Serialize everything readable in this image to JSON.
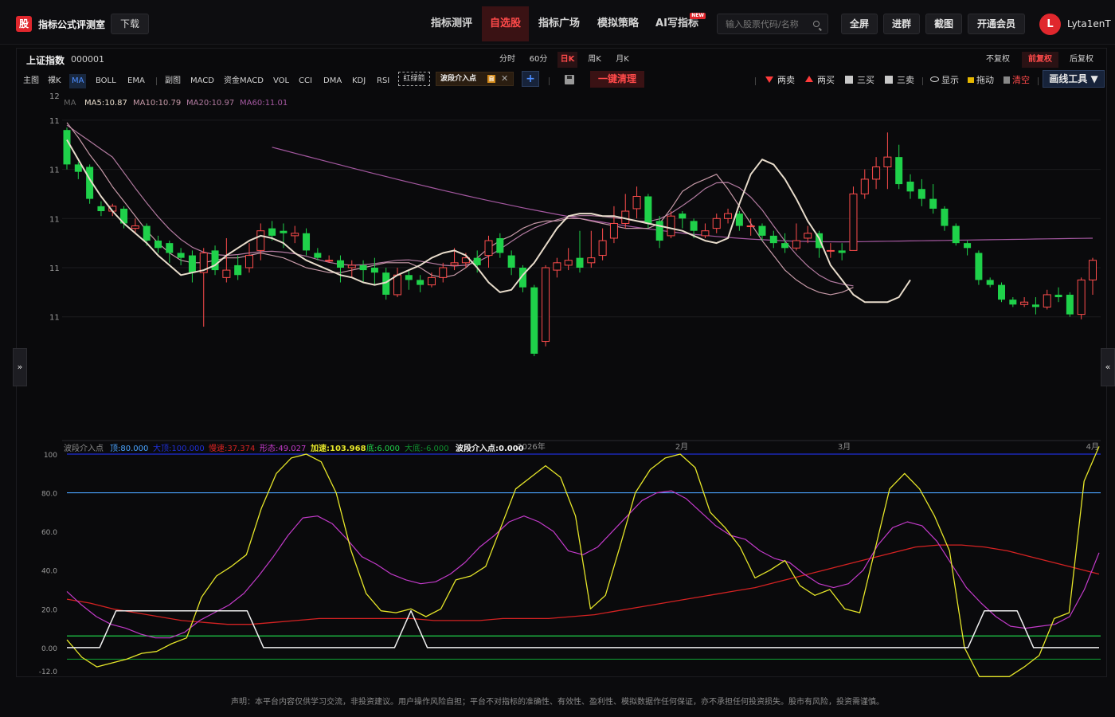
{
  "header": {
    "logo_char": "股",
    "brand": "指标公式评测室",
    "download": "下载",
    "nav": [
      {
        "label": "指标测评",
        "active": false
      },
      {
        "label": "自选股",
        "active": true
      },
      {
        "label": "指标广场",
        "active": false
      },
      {
        "label": "模拟策略",
        "active": false
      },
      {
        "label": "AI写指标",
        "active": false,
        "badge": "NEW"
      }
    ],
    "search_placeholder": "输入股票代码/名称",
    "buttons": [
      "全屏",
      "进群",
      "截图",
      "开通会员"
    ],
    "avatar_letter": "L",
    "username": "Lyta1enT"
  },
  "chart_header": {
    "index_name": "上证指数",
    "index_code": "000001",
    "periods": [
      {
        "label": "分时",
        "active": false
      },
      {
        "label": "60分",
        "active": false
      },
      {
        "label": "日K",
        "active": true
      },
      {
        "label": "周K",
        "active": false
      },
      {
        "label": "月K",
        "active": false
      }
    ],
    "adjust": [
      {
        "label": "不复权",
        "active": false
      },
      {
        "label": "前复权",
        "active": true
      },
      {
        "label": "后复权",
        "active": false
      }
    ]
  },
  "toolbar": {
    "left_items": [
      {
        "label": "主图",
        "active": false
      },
      {
        "label": "裸K",
        "active": false
      },
      {
        "label": "MA",
        "active": true
      },
      {
        "label": "BOLL",
        "active": false
      },
      {
        "label": "EMA",
        "active": false
      },
      {
        "label": "副图",
        "active": false
      },
      {
        "label": "MACD",
        "active": false
      },
      {
        "label": "资金MACD",
        "active": false
      },
      {
        "label": "VOL",
        "active": false
      },
      {
        "label": "CCI",
        "active": false
      },
      {
        "label": "DMA",
        "active": false
      },
      {
        "label": "KDJ",
        "active": false
      },
      {
        "label": "RSI",
        "active": false
      }
    ],
    "dashed_tag": "红绿箭",
    "wave_tag": "波段介入点",
    "wave_badge": "自",
    "wave_close": "✕",
    "add_label": "+",
    "clear_label": "一键清理",
    "right_items": [
      "两卖",
      "两买",
      "三买",
      "三卖",
      "显示",
      "拖动",
      "清空"
    ],
    "draw_tools": "画线工具 ▼"
  },
  "side_tabs": {
    "left": "»",
    "right": "«"
  },
  "chart_data": [
    {
      "type": "candlestick",
      "title": "",
      "legend": [
        {
          "name": "MA",
          "value": "",
          "color": "#666666"
        },
        {
          "name": "MA5",
          "value": "10.87",
          "color": "#e8dccb"
        },
        {
          "name": "MA10",
          "value": "10.79",
          "color": "#c79aa8"
        },
        {
          "name": "MA20",
          "value": "10.97",
          "color": "#b27aa0"
        },
        {
          "name": "MA60",
          "value": "11.01",
          "color": "#a458a0"
        }
      ],
      "y_tick_labels": [
        "12",
        "11",
        "11",
        "11",
        "11",
        "11"
      ],
      "x_tick_labels": [
        "2026年",
        "2月",
        "3月",
        "4月"
      ],
      "ylim": [
        10.6,
        12.0
      ],
      "colors": {
        "up": "#ff4d4d",
        "down": "#1fd14a"
      },
      "candles": [
        [
          11.86,
          11.72,
          11.87,
          11.7
        ],
        [
          11.72,
          11.69,
          11.73,
          11.66
        ],
        [
          11.71,
          11.58,
          11.72,
          11.56
        ],
        [
          11.55,
          11.53,
          11.57,
          11.51
        ],
        [
          11.53,
          11.55,
          11.56,
          11.51
        ],
        [
          11.54,
          11.48,
          11.55,
          11.46
        ],
        [
          11.46,
          11.47,
          11.5,
          11.44
        ],
        [
          11.47,
          11.41,
          11.48,
          11.39
        ],
        [
          11.41,
          11.38,
          11.43,
          11.36
        ],
        [
          11.4,
          11.36,
          11.41,
          11.32
        ],
        [
          11.36,
          11.34,
          11.38,
          11.31
        ],
        [
          11.35,
          11.28,
          11.37,
          11.24
        ],
        [
          11.28,
          11.36,
          11.38,
          11.06
        ],
        [
          11.37,
          11.29,
          11.39,
          11.27
        ],
        [
          11.26,
          11.29,
          11.42,
          11.24
        ],
        [
          11.31,
          11.27,
          11.35,
          11.25
        ],
        [
          11.3,
          11.35,
          11.4,
          11.28
        ],
        [
          11.37,
          11.45,
          11.48,
          11.33
        ],
        [
          11.46,
          11.43,
          11.49,
          11.41
        ],
        [
          11.45,
          11.44,
          11.48,
          11.38
        ],
        [
          11.43,
          11.44,
          11.47,
          11.4
        ],
        [
          11.44,
          11.37,
          11.46,
          11.35
        ],
        [
          11.36,
          11.34,
          11.38,
          11.33
        ],
        [
          11.33,
          11.33,
          11.35,
          11.32
        ],
        [
          11.33,
          11.3,
          11.35,
          11.24
        ],
        [
          11.3,
          11.31,
          11.33,
          11.26
        ],
        [
          11.31,
          11.29,
          11.33,
          11.24
        ],
        [
          11.3,
          11.28,
          11.34,
          11.23
        ],
        [
          11.28,
          11.19,
          11.3,
          11.17
        ],
        [
          11.19,
          11.27,
          11.3,
          11.18
        ],
        [
          11.27,
          11.25,
          11.29,
          11.21
        ],
        [
          11.25,
          11.23,
          11.27,
          11.2
        ],
        [
          11.23,
          11.26,
          11.28,
          11.22
        ],
        [
          11.26,
          11.3,
          11.32,
          11.24
        ],
        [
          11.31,
          11.32,
          11.38,
          11.29
        ],
        [
          11.32,
          11.34,
          11.36,
          11.3
        ],
        [
          11.34,
          11.31,
          11.37,
          11.28
        ],
        [
          11.35,
          11.41,
          11.43,
          11.3
        ],
        [
          11.42,
          11.36,
          11.44,
          11.34
        ],
        [
          11.35,
          11.3,
          11.37,
          11.27
        ],
        [
          11.3,
          11.22,
          11.31,
          11.2
        ],
        [
          11.22,
          10.95,
          11.23,
          10.94
        ],
        [
          11.0,
          11.3,
          11.31,
          10.98
        ],
        [
          11.29,
          11.32,
          11.34,
          11.26
        ],
        [
          11.31,
          11.33,
          11.38,
          11.29
        ],
        [
          11.34,
          11.3,
          11.45,
          11.28
        ],
        [
          11.32,
          11.34,
          11.45,
          11.3
        ],
        [
          11.35,
          11.41,
          11.46,
          11.33
        ],
        [
          11.42,
          11.48,
          11.55,
          11.4
        ],
        [
          11.48,
          11.53,
          11.6,
          11.46
        ],
        [
          11.54,
          11.59,
          11.63,
          11.5
        ],
        [
          11.59,
          11.48,
          11.6,
          11.46
        ],
        [
          11.49,
          11.41,
          11.51,
          11.38
        ],
        [
          11.43,
          11.51,
          11.53,
          11.42
        ],
        [
          11.52,
          11.5,
          11.53,
          11.46
        ],
        [
          11.49,
          11.45,
          11.5,
          11.42
        ],
        [
          11.43,
          11.45,
          11.48,
          11.42
        ],
        [
          11.46,
          11.5,
          11.52,
          11.44
        ],
        [
          11.5,
          11.52,
          11.54,
          11.48
        ],
        [
          11.52,
          11.47,
          11.53,
          11.45
        ],
        [
          11.47,
          11.47,
          11.5,
          11.43
        ],
        [
          11.47,
          11.43,
          11.48,
          11.41
        ],
        [
          11.43,
          11.4,
          11.45,
          11.38
        ],
        [
          11.4,
          11.38,
          11.44,
          11.36
        ],
        [
          11.38,
          11.41,
          11.48,
          11.37
        ],
        [
          11.42,
          11.44,
          11.47,
          11.4
        ],
        [
          11.44,
          11.38,
          11.45,
          11.34
        ],
        [
          11.37,
          11.37,
          11.4,
          11.34
        ],
        [
          11.37,
          11.36,
          11.4,
          11.33
        ],
        [
          11.37,
          11.6,
          11.63,
          11.58
        ],
        [
          11.6,
          11.66,
          11.7,
          11.58
        ],
        [
          11.66,
          11.71,
          11.75,
          11.62
        ],
        [
          11.71,
          11.75,
          11.85,
          11.62
        ],
        [
          11.75,
          11.64,
          11.8,
          11.62
        ],
        [
          11.65,
          11.61,
          11.68,
          11.58
        ],
        [
          11.62,
          11.58,
          11.66,
          11.55
        ],
        [
          11.58,
          11.54,
          11.64,
          11.52
        ],
        [
          11.54,
          11.47,
          11.55,
          11.45
        ],
        [
          11.47,
          11.4,
          11.48,
          11.39
        ],
        [
          11.4,
          11.38,
          11.41,
          11.35
        ],
        [
          11.36,
          11.25,
          11.37,
          11.23
        ],
        [
          11.25,
          11.23,
          11.26,
          11.22
        ],
        [
          11.23,
          11.17,
          11.24,
          11.16
        ],
        [
          11.17,
          11.15,
          11.18,
          11.14
        ],
        [
          11.15,
          11.16,
          11.18,
          11.14
        ],
        [
          11.15,
          11.14,
          11.18,
          11.11
        ],
        [
          11.14,
          11.19,
          11.21,
          11.13
        ],
        [
          11.19,
          11.18,
          11.22,
          11.16
        ],
        [
          11.19,
          11.11,
          11.2,
          11.1
        ],
        [
          11.11,
          11.25,
          11.26,
          11.09
        ],
        [
          11.25,
          11.33,
          11.34,
          11.19
        ]
      ],
      "ma5": [
        11.82,
        11.74,
        11.66,
        11.59,
        11.53,
        11.48,
        11.44,
        11.4,
        11.35,
        11.31,
        11.27,
        11.28,
        11.29,
        11.31,
        11.35,
        11.38,
        11.41,
        11.43,
        11.42,
        11.4,
        11.36,
        11.33,
        11.31,
        11.29,
        11.27,
        11.26,
        11.24,
        11.23,
        11.24,
        11.27,
        11.29,
        11.31,
        11.34,
        11.36,
        11.37,
        11.35,
        11.3,
        11.24,
        11.2,
        11.21,
        11.27,
        11.32,
        11.39,
        11.46,
        11.51,
        11.52,
        11.52,
        11.51,
        11.51,
        11.5,
        11.49,
        11.48,
        11.47,
        11.46,
        11.45,
        11.43,
        11.41,
        11.4,
        11.42,
        11.56,
        11.68,
        11.74,
        11.72,
        11.66,
        11.58,
        11.49,
        11.42,
        11.31,
        11.25,
        11.19,
        11.16,
        11.16,
        11.16,
        11.18,
        11.25
      ],
      "ma10": [
        11.89,
        11.83,
        11.76,
        11.7,
        11.63,
        11.57,
        11.51,
        11.45,
        11.4,
        11.36,
        11.33,
        11.32,
        11.32,
        11.33,
        11.34,
        11.34,
        11.35,
        11.36,
        11.35,
        11.34,
        11.32,
        11.3,
        11.29,
        11.28,
        11.28,
        11.29,
        11.3,
        11.31,
        11.32,
        11.32,
        11.32,
        11.3,
        11.27,
        11.26,
        11.27,
        11.3,
        11.34,
        11.38,
        11.41,
        11.43,
        11.46,
        11.48,
        11.49,
        11.49,
        11.5,
        11.5,
        11.49,
        11.48,
        11.47,
        11.46,
        11.46,
        11.46,
        11.48,
        11.54,
        11.61,
        11.64,
        11.66,
        11.68,
        11.62,
        11.55,
        11.48,
        11.41,
        11.35,
        11.29,
        11.25,
        11.22,
        11.2,
        11.19,
        11.2,
        11.22
      ]
    },
    {
      "type": "line",
      "title": "",
      "legend": [
        {
          "name": "波段介入点",
          "value": "",
          "color": "#888888"
        },
        {
          "name": "顶",
          "value": "80.000",
          "color": "#4aa3ff"
        },
        {
          "name": "大顶",
          "value": "100.000",
          "color": "#1f2fd6"
        },
        {
          "name": "慢速",
          "value": "37.374",
          "color": "#d42222"
        },
        {
          "name": "形态",
          "value": "49.027",
          "color": "#c23ac9"
        },
        {
          "name": "加速",
          "value": "103.968",
          "color": "#e6e629"
        },
        {
          "name": "底",
          "value": "6.000",
          "color": "#1fd14a"
        },
        {
          "name": "大底",
          "value": "-6.000",
          "color": "#0f8f2f"
        },
        {
          "name": "波段介入点",
          "value": "0.000",
          "color": "#f0f0f0"
        }
      ],
      "y_tick_labels": [
        "100",
        "80.0",
        "60.0",
        "40.0",
        "20.0",
        "0.00",
        "-12.0"
      ],
      "ylim": [
        -12,
        100
      ],
      "levels": {
        "top": 80,
        "big_top": 100,
        "bottom": 6,
        "big_bottom": -6
      },
      "fast": [
        4,
        -5,
        -10,
        -8,
        -6,
        -3,
        -2,
        2,
        5,
        26,
        37,
        42,
        48,
        72,
        90,
        98,
        100,
        96,
        80,
        50,
        28,
        19,
        18,
        20,
        16,
        20,
        35,
        37,
        42,
        62,
        82,
        88,
        94,
        88,
        68,
        20,
        27,
        53,
        80,
        92,
        98,
        100,
        93,
        70,
        62,
        52,
        36,
        40,
        45,
        32,
        27,
        30,
        20,
        18,
        50,
        82,
        90,
        82,
        68,
        50,
        0,
        -15,
        -15,
        -15,
        -10,
        -4,
        15,
        18,
        86,
        103.968
      ],
      "slow": [
        25,
        23,
        20,
        18,
        16,
        14,
        13,
        12,
        12,
        13,
        14,
        15,
        15,
        15,
        15,
        15,
        14,
        14,
        14,
        15,
        15,
        15,
        16,
        17,
        19,
        21,
        23,
        25,
        27,
        29,
        31,
        34,
        37,
        40,
        43,
        46,
        49,
        52,
        53,
        53,
        52,
        50,
        47,
        44,
        41,
        38
      ],
      "form": [
        29,
        22,
        16,
        12,
        10,
        7,
        5,
        5,
        8,
        14,
        18,
        22,
        28,
        37,
        47,
        58,
        67,
        68,
        64,
        56,
        47,
        43,
        38,
        35,
        33,
        34,
        38,
        44,
        52,
        58,
        65,
        68,
        65,
        60,
        50,
        48,
        52,
        60,
        68,
        76,
        80,
        81,
        77,
        70,
        63,
        58,
        56,
        50,
        46,
        44,
        38,
        33,
        31,
        33,
        40,
        53,
        62,
        65,
        63,
        55,
        43,
        31,
        23,
        16,
        11,
        10,
        11,
        12,
        16,
        30,
        49.027
      ],
      "entry": [
        0,
        0,
        0,
        19,
        19,
        19,
        19,
        19,
        19,
        19,
        19,
        19,
        0,
        0,
        0,
        0,
        0,
        0,
        0,
        0,
        0,
        19,
        0,
        0,
        0,
        0,
        0,
        0,
        0,
        0,
        0,
        0,
        0,
        0,
        0,
        0,
        0,
        0,
        0,
        0,
        0,
        0,
        0,
        0,
        0,
        0,
        0,
        0,
        0,
        0,
        0,
        0,
        0,
        0,
        0,
        0,
        19,
        19,
        19,
        0,
        0,
        0,
        0,
        0
      ]
    }
  ],
  "footer": "声明：本平台内容仅供学习交流，非投资建议。用户操作风险自担；平台不对指标的准确性、有效性、盈利性、模拟数据作任何保证，亦不承担任何投资损失。股市有风险，投资需谨慎。"
}
